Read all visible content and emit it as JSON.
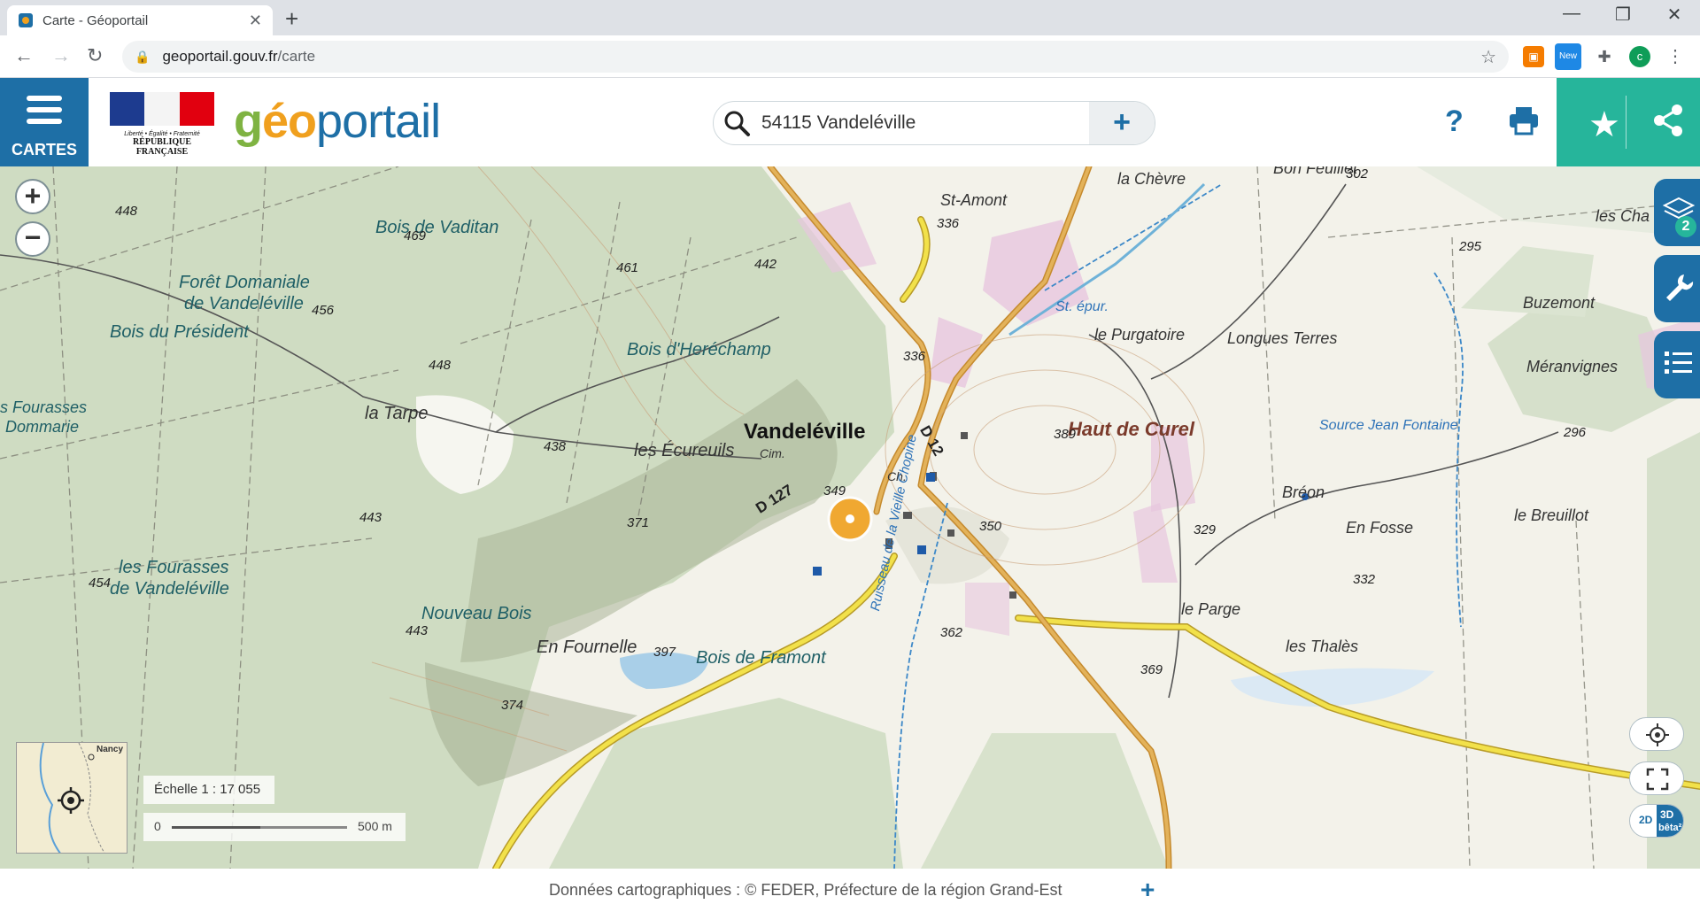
{
  "browser": {
    "tab_title": "Carte - Géoportail",
    "tab_close": "✕",
    "new_tab": "+",
    "url_domain": "geoportail.gouv.fr",
    "url_path": "/carte",
    "ext_new_label": "New",
    "profile_initial": "c"
  },
  "header": {
    "menu_label": "CARTES",
    "republic_motto": "Liberté • Égalité • Fraternité",
    "republic_name": "RÉPUBLIQUE FRANÇAISE",
    "logo_part1": "g",
    "logo_part2": "éo",
    "logo_part3": "portail",
    "search_value": "54115 Vandeléville",
    "help_label": "?"
  },
  "map": {
    "place_labels": {
      "bois_vaditan": "Bois de Vaditan",
      "foret_domaniale": "Forêt Domaniale",
      "foret_domaniale_2": "de Vandeléville",
      "bois_president": "Bois du Président",
      "bois_herechamp": "Bois d'Heréchamp",
      "fourasses_dommarie": "s Fourasses",
      "dommarie": "Dommarie",
      "la_tarpe": "la Tarpe",
      "vandeleville": "Vandeléville",
      "les_ecureuils": "les Écureuils",
      "cim": "Cim.",
      "ch": "Ch.",
      "fourasses_vand": "les Fourasses",
      "fourasses_vand_2": "de Vandeléville",
      "nouveau_bois": "Nouveau Bois",
      "en_fournelle": "En Fournelle",
      "bois_framont": "Bois de Framont",
      "st_amont": "St-Amont",
      "la_chevre": "la Chèvre",
      "bon_feuillet": "Bon Feuillet",
      "st_epur": "St. épur.",
      "le_purgatoire": "le Purgatoire",
      "longues_terres": "Longues Terres",
      "haut_de_curel": "Haut de Curel",
      "source_jean_fontaine": "Source Jean Fontaine",
      "breon": "Bréon",
      "en_fosse": "En Fosse",
      "le_breuillot": "le Breuillot",
      "le_parge": "le Parge",
      "les_thales": "les Thalès",
      "buzemont": "Buzemont",
      "meranvignes": "Méranvignes",
      "les_cha": "les Cha",
      "ruisseau": "Ruisseau de la Vieille Chopine",
      "d12": "D 12",
      "d127": "D 127"
    },
    "elevations": [
      "448",
      "469",
      "461",
      "442",
      "456",
      "448",
      "438",
      "443",
      "454",
      "443",
      "374",
      "371",
      "349",
      "336",
      "336",
      "389",
      "350",
      "329",
      "302",
      "295",
      "296",
      "332",
      "362",
      "369",
      "397"
    ],
    "zoom_in": "+",
    "zoom_out": "−",
    "layers_count": "2",
    "minimap_label": "Nancy",
    "scale_text": "Échelle 1 : 17 055",
    "scale_zero": "0",
    "scale_end": "500 m",
    "btn_2d": "2D",
    "btn_3d": "3D",
    "btn_beta": "bêta²"
  },
  "footer": {
    "attribution": "Données cartographiques : ©    FEDER,  Préfecture de la région Grand-Est",
    "attribution_plus": "+"
  },
  "colors": {
    "primary_blue": "#1e6fa6",
    "teal": "#26b59b",
    "forest": "#cdd9bf",
    "road_orange": "#d9a441",
    "road_yellow": "#f2e14a"
  }
}
